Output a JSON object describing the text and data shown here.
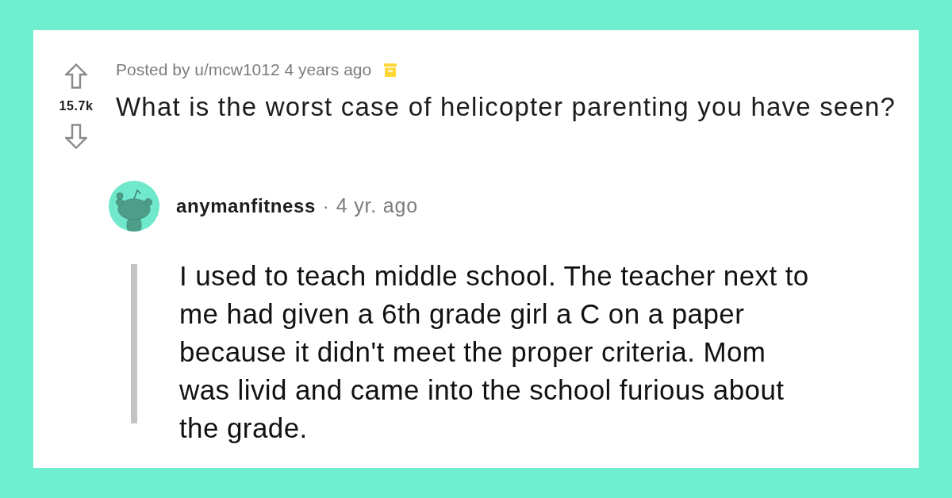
{
  "post": {
    "score": "15.7k",
    "byline": "Posted by u/mcw1012 4 years ago",
    "title": "What is the worst case of helicopter parenting you have seen?"
  },
  "comment": {
    "author": "anymanfitness",
    "separator": "·",
    "time": "4 yr. ago",
    "body": "I used to teach middle school. The teacher next to me had given a 6th grade girl a C on a paper because it didn't meet the proper criteria. Mom was livid and came into the school furious about the grade."
  }
}
